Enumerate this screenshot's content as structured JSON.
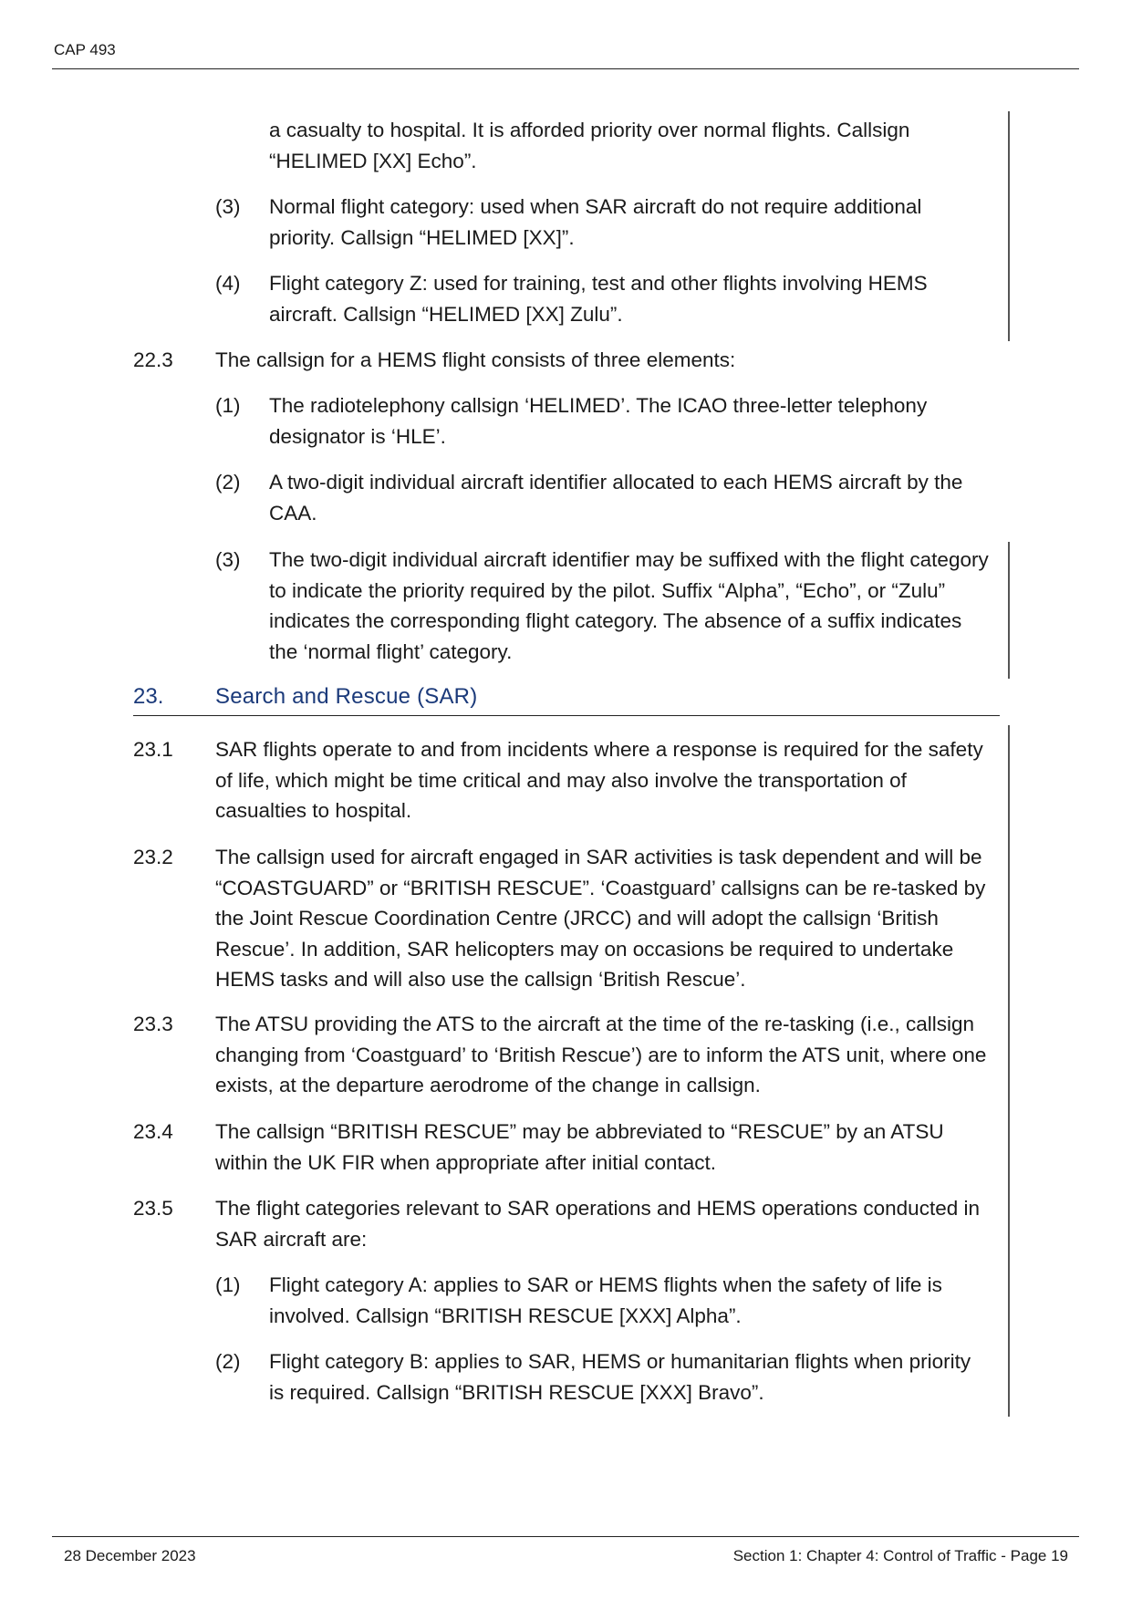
{
  "header": {
    "doc_id": "CAP 493"
  },
  "footer": {
    "date": "28 December 2023",
    "page_ref": "Section 1: Chapter 4: Control of Traffic - Page 19"
  },
  "continued": {
    "text": "a casualty to hospital. It is afforded priority over normal flights. Callsign “HELIMED [XX] Echo”."
  },
  "items_22_2": [
    {
      "num": "(3)",
      "text": "Normal flight category: used when SAR aircraft do not require additional priority. Callsign “HELIMED [XX]”."
    },
    {
      "num": "(4)",
      "text": "Flight category Z: used for training, test and other flights involving HEMS aircraft. Callsign “HELIMED [XX] Zulu”."
    }
  ],
  "para_22_3": {
    "num": "22.3",
    "text": "The callsign for a HEMS flight consists of three elements:",
    "items": [
      {
        "num": "(1)",
        "text": "The radiotelephony callsign ‘HELIMED’. The ICAO three-letter telephony designator is ‘HLE’."
      },
      {
        "num": "(2)",
        "text": "A two-digit individual aircraft identifier allocated to each HEMS aircraft by the CAA."
      },
      {
        "num": "(3)",
        "text": "The two-digit individual aircraft identifier may be suffixed with the flight category to indicate the priority required by the pilot. Suffix “Alpha”, “Echo”, or “Zulu” indicates the corresponding flight category. The absence of a suffix indicates the ‘normal flight’ category."
      }
    ]
  },
  "section_23": {
    "num": "23.",
    "title": "Search and Rescue (SAR)"
  },
  "paras_23": [
    {
      "num": "23.1",
      "text": "SAR flights operate to and from incidents where a response is required for the safety of life, which might be time critical and may also involve the transportation of casualties to hospital."
    },
    {
      "num": "23.2",
      "text": "The callsign used for aircraft engaged in SAR activities is task dependent and will be “COASTGUARD” or “BRITISH RESCUE”. ‘Coastguard’ callsigns can be re-tasked by the Joint Rescue Coordination Centre (JRCC) and will adopt the callsign ‘British Rescue’. In addition, SAR helicopters may on occasions be required to undertake HEMS tasks and will also use the callsign ‘British Rescue’."
    },
    {
      "num": "23.3",
      "text": "The ATSU providing the ATS to the aircraft at the time of the re-tasking (i.e., callsign changing from ‘Coastguard’ to ‘British Rescue’) are to inform the ATS unit, where one exists, at the departure aerodrome of the change in callsign."
    },
    {
      "num": "23.4",
      "text": "The callsign “BRITISH RESCUE” may be abbreviated to “RESCUE” by an ATSU within the UK FIR when appropriate after initial contact."
    },
    {
      "num": "23.5",
      "text": "The flight categories relevant to SAR operations and HEMS operations conducted in SAR aircraft are:"
    }
  ],
  "items_23_5": [
    {
      "num": "(1)",
      "text": "Flight category A: applies to SAR or HEMS flights when the safety of life is involved. Callsign “BRITISH RESCUE [XXX] Alpha”."
    },
    {
      "num": "(2)",
      "text": "Flight category B: applies to SAR, HEMS or humanitarian flights when priority is required. Callsign “BRITISH RESCUE [XXX] Bravo”."
    }
  ]
}
